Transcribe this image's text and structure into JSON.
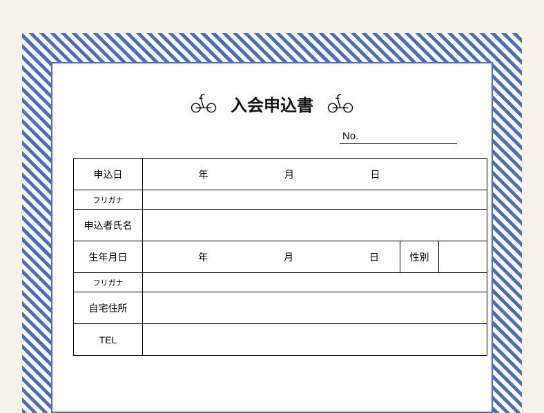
{
  "title": "入会申込書",
  "no_label": "No.",
  "no_value": "",
  "rows": {
    "application_date_label": "申込日",
    "year_unit": "年",
    "month_unit": "月",
    "day_unit": "日",
    "furigana1_label": "フリガナ",
    "applicant_name_label": "申込者氏名",
    "birthday_label": "生年月日",
    "gender_label": "性別",
    "furigana2_label": "フリガナ",
    "home_address_label": "自宅住所",
    "tel_label": "TEL"
  },
  "values": {
    "app_year": "",
    "app_month": "",
    "app_day": "",
    "furigana1": "",
    "applicant_name": "",
    "birth_year": "",
    "birth_month": "",
    "birth_day": "",
    "gender": "",
    "furigana2": "",
    "home_address": "",
    "tel": ""
  },
  "icons": {
    "left_icon": "bicycle-icon",
    "right_icon": "bicycle-icon"
  }
}
